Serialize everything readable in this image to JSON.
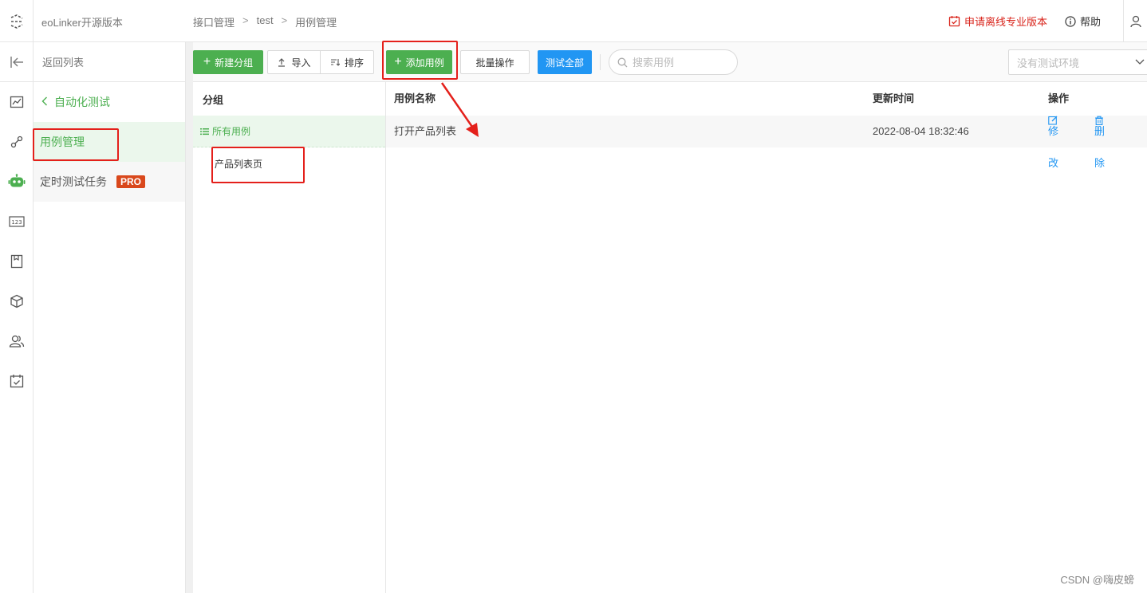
{
  "header": {
    "app_name": "eoLinker开源版本",
    "breadcrumb": [
      "接口管理",
      "test",
      "用例管理"
    ],
    "breadcrumb_sep": ">",
    "apply_pro": "申请离线专业版本",
    "help": "帮助"
  },
  "rail": {
    "items": [
      "chart-icon",
      "link-icon",
      "robot-icon",
      "number-icon",
      "document-icon",
      "cube-icon",
      "users-icon",
      "calendar-icon"
    ],
    "active_index": 2
  },
  "subnav": {
    "back_label": "返回列表",
    "section_title": "自动化测试",
    "items": [
      {
        "label": "用例管理",
        "active": true
      },
      {
        "label": "定时测试任务",
        "badge": "PRO"
      }
    ]
  },
  "toolbar": {
    "new_group": "新建分组",
    "import": "导入",
    "sort": "排序",
    "add_case": "添加用例",
    "batch": "批量操作",
    "test_all": "测试全部",
    "search_placeholder": "搜索用例",
    "env_placeholder": "没有测试环境"
  },
  "groups": {
    "header": "分组",
    "all": "所有用例",
    "items": [
      "产品列表页"
    ]
  },
  "table": {
    "columns": [
      "用例名称",
      "更新时间",
      "操作"
    ],
    "rows": [
      {
        "name": "打开产品列表",
        "updated": "2022-08-04 18:32:46",
        "edit": "修改",
        "delete": "删除"
      }
    ]
  },
  "colors": {
    "accent_green": "#4caf50",
    "primary_blue": "#2196f3",
    "annotation_red": "#e4201b"
  },
  "watermark": "CSDN @嗨皮螃"
}
